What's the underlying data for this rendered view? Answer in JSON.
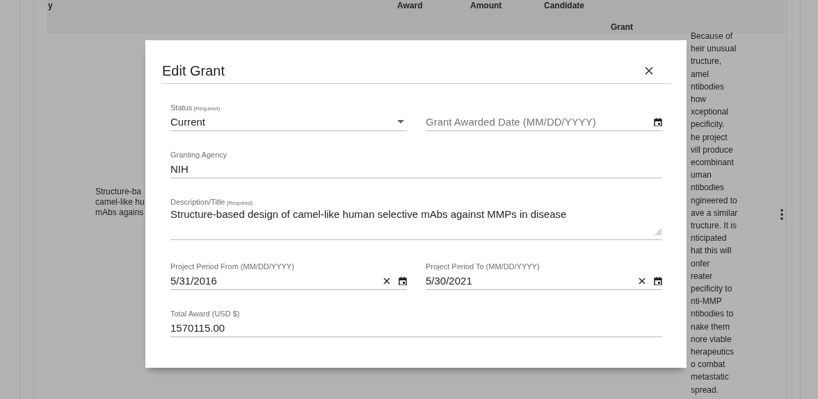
{
  "table": {
    "columns": [
      {
        "label": "y"
      },
      {
        "label": "Award"
      },
      {
        "label": "Amount"
      },
      {
        "label": "Candidate"
      },
      {
        "label": "Grant"
      }
    ],
    "rows": [
      {
        "title_lines": [
          "Structure-ba",
          "camel-like hu",
          "mAbs agains"
        ],
        "description_lines": [
          "Because of",
          "heir unusual",
          "tructure,",
          "amel",
          "ntibodies",
          "how",
          "xceptional",
          "pecificity.",
          "he project",
          "vill produce",
          "ecombinant",
          "uman",
          "ntibodies",
          "ngineered to",
          "ave a similar",
          "tructure. It is",
          "nticipated",
          "hat this will",
          "onfer",
          "reater",
          "pecificity to",
          "nti-MMP",
          "ntibodies to",
          "nake them",
          "nore viable",
          "herapeutics",
          "o combat",
          "metastatic",
          "spread."
        ]
      }
    ]
  },
  "dialog": {
    "title": "Edit Grant",
    "rows": [
      [
        {
          "kind": "select",
          "label": "Status",
          "note": "(Required)",
          "value": "Current"
        },
        {
          "kind": "date",
          "placeholder": "Grant Awarded Date (MM/DD/YYYY)",
          "clearable": false
        }
      ],
      [
        {
          "kind": "text",
          "label": "Granting Agency",
          "value": "NIH"
        }
      ],
      [
        {
          "kind": "textarea",
          "label": "Description/Title",
          "note": "(Required)",
          "value": "Structure-based design of camel-like human selective mAbs against MMPs in disease"
        }
      ],
      [
        {
          "kind": "date",
          "label": "Project Period From (MM/DD/YYYY)",
          "value": "5/31/2016",
          "clearable": true
        },
        {
          "kind": "date",
          "label": "Project Period To (MM/DD/YYYY)",
          "value": "5/30/2021",
          "clearable": true
        }
      ],
      [
        {
          "kind": "text",
          "label": "Total Award (USD $)",
          "value": "1570115.00"
        }
      ]
    ]
  }
}
